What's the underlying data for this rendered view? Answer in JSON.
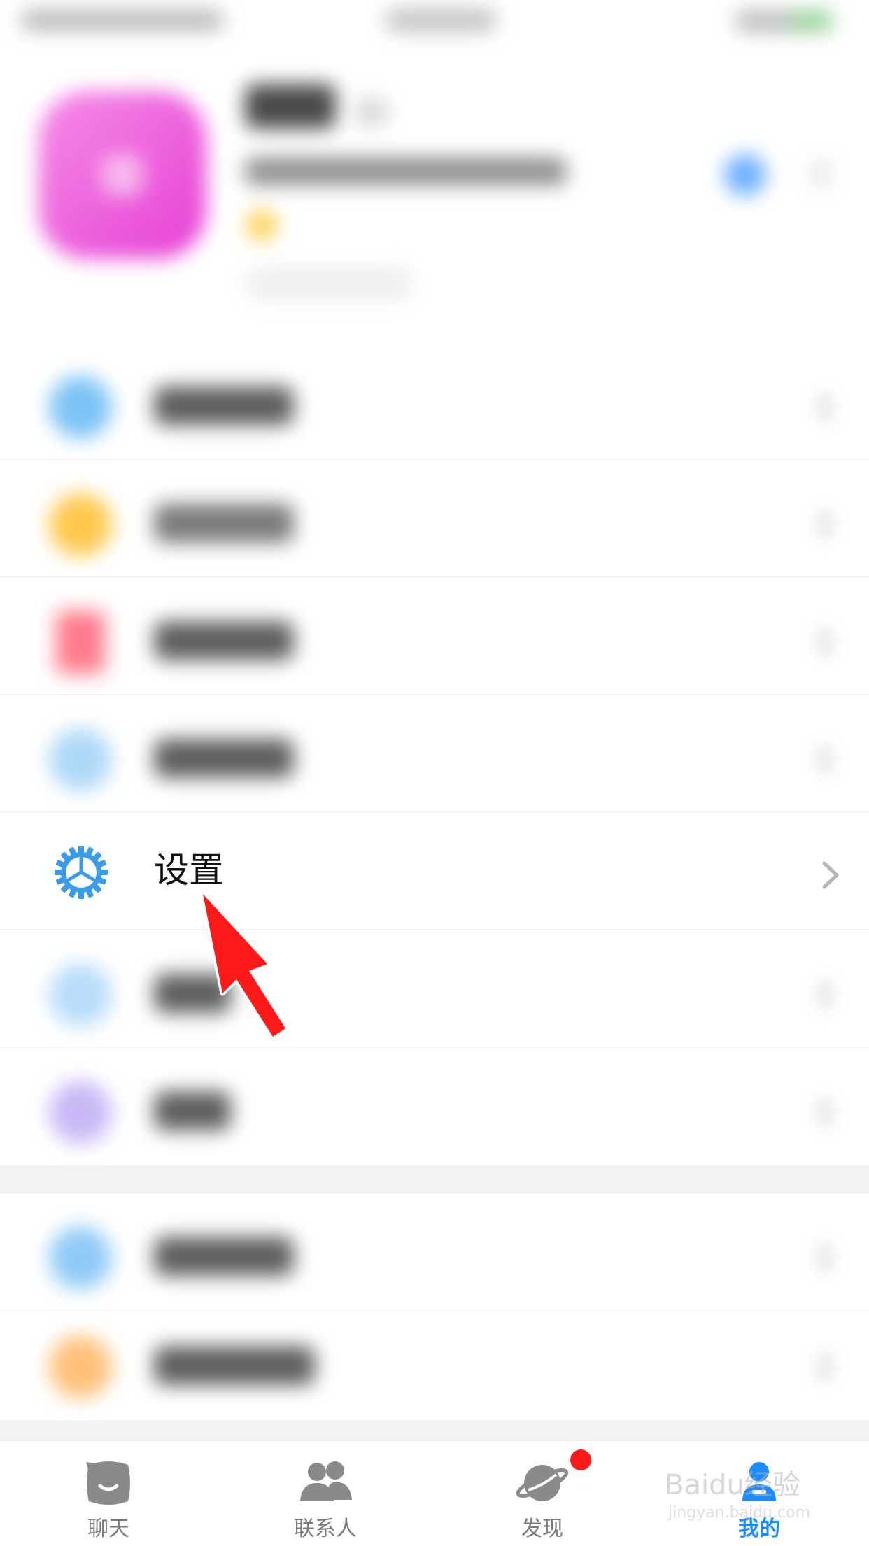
{
  "menu": {
    "settings_label": "设置"
  },
  "tabs": [
    {
      "label": "聊天",
      "icon": "chat-bubble-icon",
      "active": false
    },
    {
      "label": "联系人",
      "icon": "contacts-icon",
      "active": false
    },
    {
      "label": "发现",
      "icon": "planet-icon",
      "active": false,
      "has_dot": true
    },
    {
      "label": "我的",
      "icon": "profile-icon",
      "active": true
    }
  ],
  "watermark": {
    "brand": "Baidu经验",
    "url": "jingyan.baidu.com"
  },
  "colors": {
    "active_tab": "#1a8cff",
    "settings_icon": "#3a9be8",
    "arrow": "#ff1a1a",
    "badge": "#ff1a1a"
  }
}
